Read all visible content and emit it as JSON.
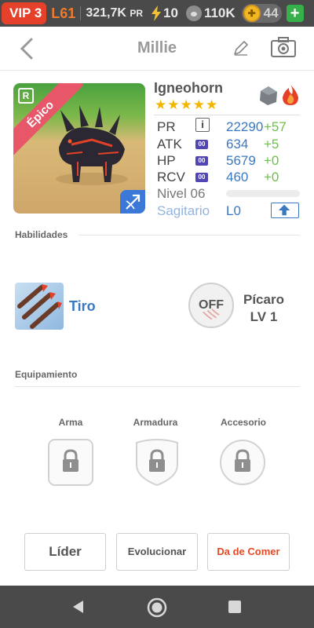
{
  "status_bar": {
    "vip": "VIP 3",
    "level": "L61",
    "power": "321,7K",
    "power_suffix": "PR",
    "energy": "10",
    "paws": "110K",
    "coins": "44"
  },
  "header": {
    "title": "Millie"
  },
  "pet": {
    "rarity": "Épico",
    "r_badge": "R",
    "name": "Igneohorn",
    "stars": "★★★★★",
    "stats": [
      {
        "label": "PR",
        "tag": "i",
        "value": "22290",
        "inc": "+57"
      },
      {
        "label": "ATK",
        "tag": "00",
        "value": "634",
        "inc": "+5"
      },
      {
        "label": "HP",
        "tag": "00",
        "value": "5679",
        "inc": "+0"
      },
      {
        "label": "RCV",
        "tag": "00",
        "value": "460",
        "inc": "+0"
      }
    ],
    "level_label": "Nivel 06",
    "class": "Sagitario",
    "class_level": "L0"
  },
  "abilities": {
    "section_title": "Habilidades",
    "skill_name": "Tiro",
    "toggle": "OFF",
    "role": "Pícaro",
    "role_level": "LV 1"
  },
  "equipment": {
    "section_title": "Equipamiento",
    "slots": [
      "Arma",
      "Armadura",
      "Accesorio"
    ]
  },
  "actions": {
    "leader": "Líder",
    "evolve": "Evolucionar",
    "feed": "Da de Comer"
  },
  "colors": {
    "accent_blue": "#3a78c2",
    "increase_green": "#6cc04a",
    "feed_red": "#e44a24",
    "vip_red": "#e5412a"
  }
}
